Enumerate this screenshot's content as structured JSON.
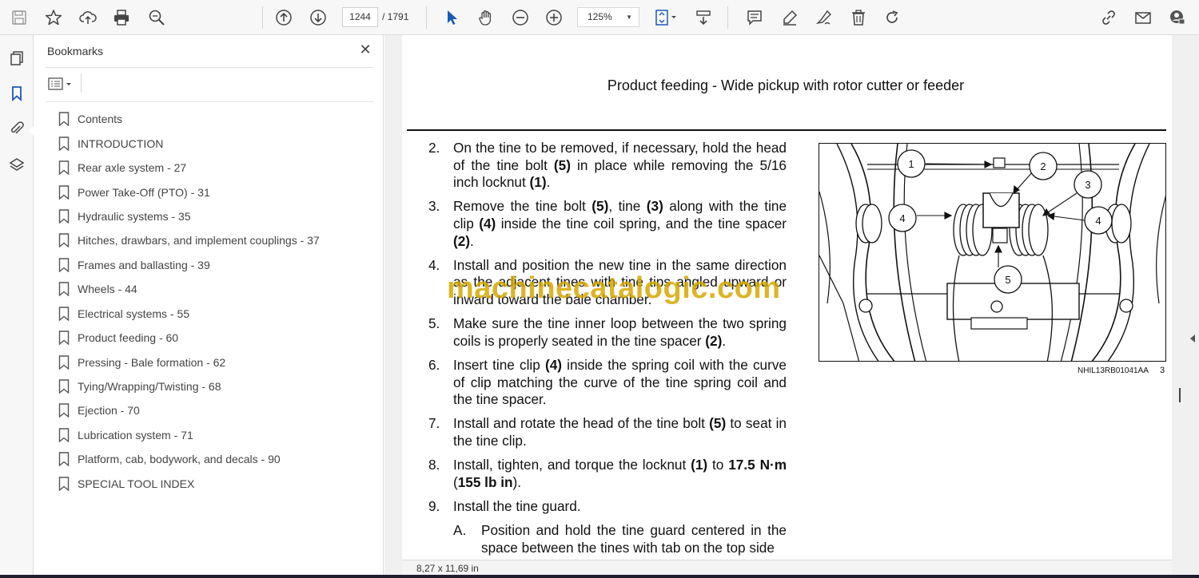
{
  "toolbar": {
    "current_page": "1244",
    "total_pages": "/ 1791",
    "zoom": "125%"
  },
  "bookmarks": {
    "title": "Bookmarks",
    "close": "✕",
    "items": [
      {
        "label": "Contents"
      },
      {
        "label": "INTRODUCTION"
      },
      {
        "label": "Rear axle system - 27"
      },
      {
        "label": "Power Take-Off (PTO) - 31"
      },
      {
        "label": "Hydraulic systems - 35"
      },
      {
        "label": "Hitches, drawbars, and implement couplings - 37"
      },
      {
        "label": "Frames and ballasting - 39"
      },
      {
        "label": "Wheels - 44"
      },
      {
        "label": "Electrical systems - 55"
      },
      {
        "label": "Product feeding - 60"
      },
      {
        "label": "Pressing - Bale formation - 62"
      },
      {
        "label": "Tying/Wrapping/Twisting - 68"
      },
      {
        "label": "Ejection - 70"
      },
      {
        "label": "Lubrication system - 71"
      },
      {
        "label": "Platform, cab, bodywork, and decals - 90"
      },
      {
        "label": "SPECIAL TOOL INDEX"
      }
    ]
  },
  "document": {
    "header": "Product feeding - Wide pickup with rotor cutter or feeder",
    "steps": [
      {
        "num": "2.",
        "html": "On the tine to be removed, if necessary, hold the head of the tine bolt <b>(5)</b> in place while removing the 5/16 inch locknut <b>(1)</b>."
      },
      {
        "num": "3.",
        "html": "Remove the tine bolt <b>(5)</b>, tine <b>(3)</b> along with the tine clip <b>(4)</b> inside the tine coil spring, and the tine spacer <b>(2)</b>."
      },
      {
        "num": "4.",
        "html": "Install and position the new tine in the same direction as the adjacent tines with tine tips angled upward or inward toward the bale chamber."
      },
      {
        "num": "5.",
        "html": "Make sure the tine inner loop between the two spring coils is properly seated in the tine spacer <b>(2)</b>."
      },
      {
        "num": "6.",
        "html": "Insert tine clip <b>(4)</b> inside the spring coil with the curve of clip matching the curve of the tine spring coil and the tine spacer."
      },
      {
        "num": "7.",
        "html": "Install and rotate the head of the tine bolt <b>(5)</b> to seat in the tine clip."
      },
      {
        "num": "8.",
        "html": "Install, tighten, and torque the locknut <b>(1)</b> to <b>17.5 N·m</b> (<b>155 lb in</b>)."
      },
      {
        "num": "9.",
        "html": "Install the tine guard."
      }
    ],
    "substep": {
      "num": "A.",
      "html": "Position and hold the tine guard centered in the space between the tines with tab on the top side"
    },
    "figure_callouts": [
      "1",
      "2",
      "3",
      "4",
      "4",
      "5"
    ],
    "figure_caption": "NHIL13RB01041AA",
    "figure_number": "3",
    "watermark": "machinecatalogic.com",
    "page_size": "8,27 x 11,69 in"
  }
}
